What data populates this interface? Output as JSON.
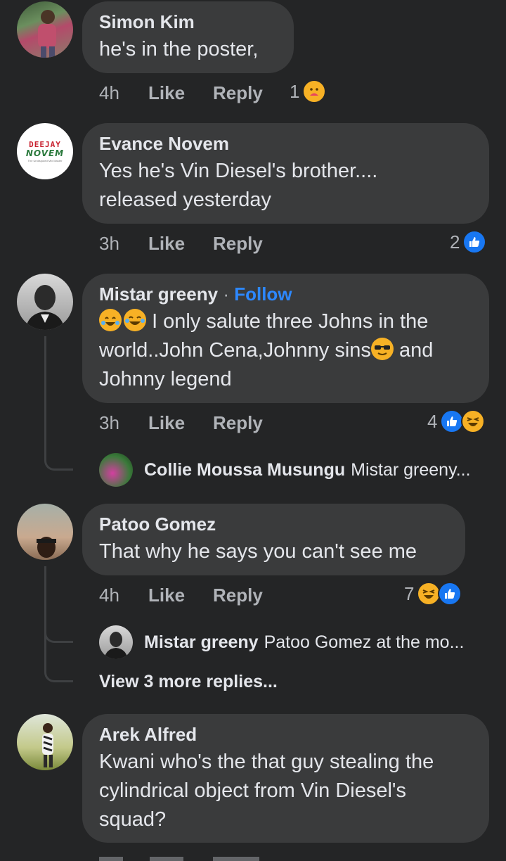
{
  "comments": [
    {
      "author": "Simon Kim",
      "text": "he's in the poster,",
      "time": "4h",
      "like_label": "Like",
      "reply_label": "Reply",
      "reaction_count": "1",
      "reactions": [
        "care"
      ]
    },
    {
      "author": "Evance Novem",
      "avatar_text_top": "DEEJAY",
      "avatar_text_bottom": "NOVEM",
      "avatar_tagline": "The Undisputed Mix Master",
      "text_line1": "Yes he's Vin Diesel's brother....",
      "text_line2": "released yesterday",
      "time": "3h",
      "like_label": "Like",
      "reply_label": "Reply",
      "reaction_count": "2",
      "reactions": [
        "like"
      ]
    },
    {
      "author": "Mistar greeny",
      "separator": "·",
      "follow_label": "Follow",
      "text_line1": "I only salute three Johns in the",
      "text_line2a": "world..John Cena,Johnny sins",
      "text_line2b": "and",
      "text_line3": "Johnny legend",
      "time": "3h",
      "like_label": "Like",
      "reply_label": "Reply",
      "reaction_count": "4",
      "reactions": [
        "like",
        "haha"
      ],
      "reply_preview": {
        "author": "Collie Moussa Musungu",
        "text": "Mistar greeny..."
      }
    },
    {
      "author": "Patoo Gomez",
      "text": "That why he says you can't see me",
      "time": "4h",
      "like_label": "Like",
      "reply_label": "Reply",
      "reaction_count": "7",
      "reactions": [
        "haha",
        "like"
      ],
      "reply_preview": {
        "author": "Mistar greeny",
        "text": "Patoo Gomez at the mo..."
      },
      "view_more_label": "View 3 more replies..."
    },
    {
      "author": "Arek Alfred",
      "text_line1": "Kwani who's the that guy stealing the",
      "text_line2": "cylindrical object from Vin Diesel's",
      "text_line3": "squad?"
    }
  ],
  "colors": {
    "background": "#242526",
    "bubble": "#3a3b3c",
    "primary_text": "#e4e6eb",
    "secondary_text": "#b0b3b8",
    "link_blue": "#2d88ff",
    "like_blue": "#1877f2",
    "haha_yellow": "#f7b125"
  }
}
